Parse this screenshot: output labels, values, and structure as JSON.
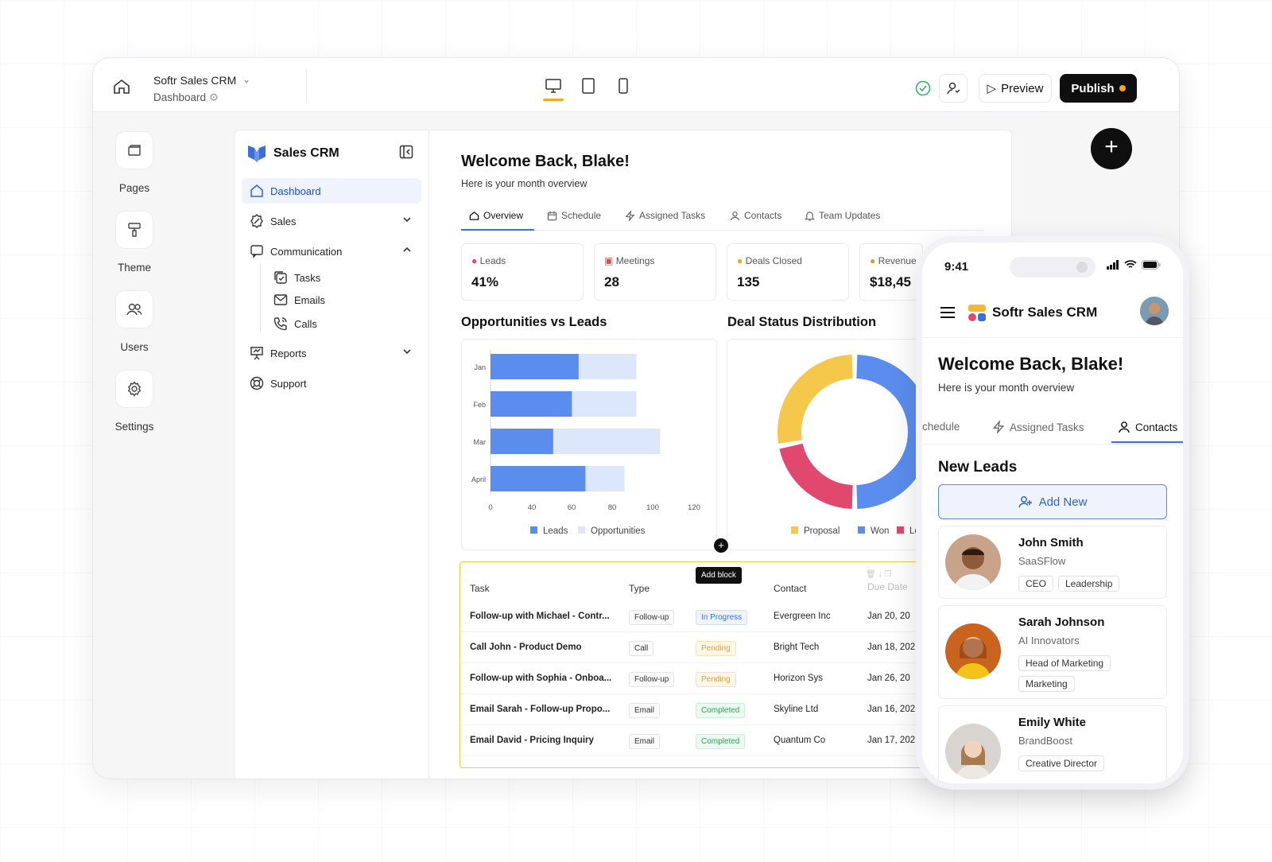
{
  "editor": {
    "app_name": "Softr Sales CRM",
    "page_name": "Dashboard",
    "preview_label": "Preview",
    "publish_label": "Publish",
    "accent": "#f5a623"
  },
  "rail": [
    {
      "label": "Pages"
    },
    {
      "label": "Theme"
    },
    {
      "label": "Users"
    },
    {
      "label": "Settings"
    }
  ],
  "sidebar": {
    "brand": "Sales CRM",
    "items": [
      {
        "label": "Dashboard"
      },
      {
        "label": "Sales"
      },
      {
        "label": "Communication"
      },
      {
        "label": "Reports"
      },
      {
        "label": "Support"
      }
    ],
    "subitems": [
      {
        "label": "Tasks"
      },
      {
        "label": "Emails"
      },
      {
        "label": "Calls"
      }
    ]
  },
  "main": {
    "title": "Welcome Back, Blake!",
    "subtitle": "Here is your month overview",
    "tabs": [
      {
        "label": "Overview"
      },
      {
        "label": "Schedule"
      },
      {
        "label": "Assigned Tasks"
      },
      {
        "label": "Contacts"
      },
      {
        "label": "Team Updates"
      }
    ],
    "kpis": [
      {
        "label": "Leads",
        "value": "41%"
      },
      {
        "label": "Meetings",
        "value": "28"
      },
      {
        "label": "Deals Closed",
        "value": "135"
      },
      {
        "label": "Revenue",
        "value": "$18,45"
      }
    ],
    "chart1_title": "Opportunities vs Leads",
    "chart2_title": "Deal Status Distribution",
    "add_block": "Add block"
  },
  "chart_data": [
    {
      "type": "bar",
      "orientation": "horizontal",
      "stacked": true,
      "categories": [
        "Jan",
        "Feb",
        "Mar",
        "April"
      ],
      "series": [
        {
          "name": "Leads",
          "values": [
            52,
            48,
            37,
            56
          ],
          "color": "#5b8def"
        },
        {
          "name": "Opportunities",
          "values": [
            34,
            38,
            63,
            23
          ],
          "color": "#dde7fb"
        }
      ],
      "xticks": [
        "0",
        "40",
        "60",
        "80",
        "100",
        "120"
      ],
      "xlim": [
        0,
        120
      ],
      "legend": "bottom"
    },
    {
      "type": "pie",
      "donut": true,
      "categories": [
        "Proposal",
        "Won",
        "Lost"
      ],
      "values": [
        28,
        50,
        22
      ],
      "colors": [
        "#f5c84c",
        "#5b8def",
        "#e0486e"
      ],
      "legend": "bottom"
    }
  ],
  "table": {
    "headers": [
      "Task",
      "Type",
      "Contact",
      "Due Date"
    ],
    "rows": [
      {
        "task": "Follow-up with Michael - Contr...",
        "type": "Follow-up",
        "status": "In Progress",
        "contact": "Evergreen Inc",
        "due": "Jan 20, 20"
      },
      {
        "task": "Call John - Product Demo",
        "type": "Call",
        "status": "Pending",
        "contact": "Bright Tech",
        "due": "Jan 18, 202"
      },
      {
        "task": "Follow-up with Sophia - Onboa...",
        "type": "Follow-up",
        "status": "Pending",
        "contact": "Horizon Sys",
        "due": "Jan 26, 20"
      },
      {
        "task": "Email Sarah - Follow-up Propo...",
        "type": "Email",
        "status": "Completed",
        "contact": "Skyline Ltd",
        "due": "Jan 16, 202"
      },
      {
        "task": "Email David - Pricing Inquiry",
        "type": "Email",
        "status": "Completed",
        "contact": "Quantum Co",
        "due": "Jan 17, 202"
      }
    ]
  },
  "phone": {
    "time": "9:41",
    "app_title": "Softr Sales CRM",
    "title": "Welcome Back, Blake!",
    "subtitle": "Here is your month overview",
    "tabs": [
      {
        "label": "chedule"
      },
      {
        "label": "Assigned Tasks"
      },
      {
        "label": "Contacts"
      }
    ],
    "section": "New Leads",
    "add_new": "Add New",
    "contacts": [
      {
        "name": "John Smith",
        "company": "SaaSFlow",
        "tags": [
          "CEO",
          "Leadership"
        ]
      },
      {
        "name": "Sarah Johnson",
        "company": "AI Innovators",
        "tags": [
          "Head of Marketing",
          "Marketing"
        ]
      },
      {
        "name": "Emily White",
        "company": "BrandBoost",
        "tags": [
          "Creative Director"
        ]
      }
    ]
  }
}
